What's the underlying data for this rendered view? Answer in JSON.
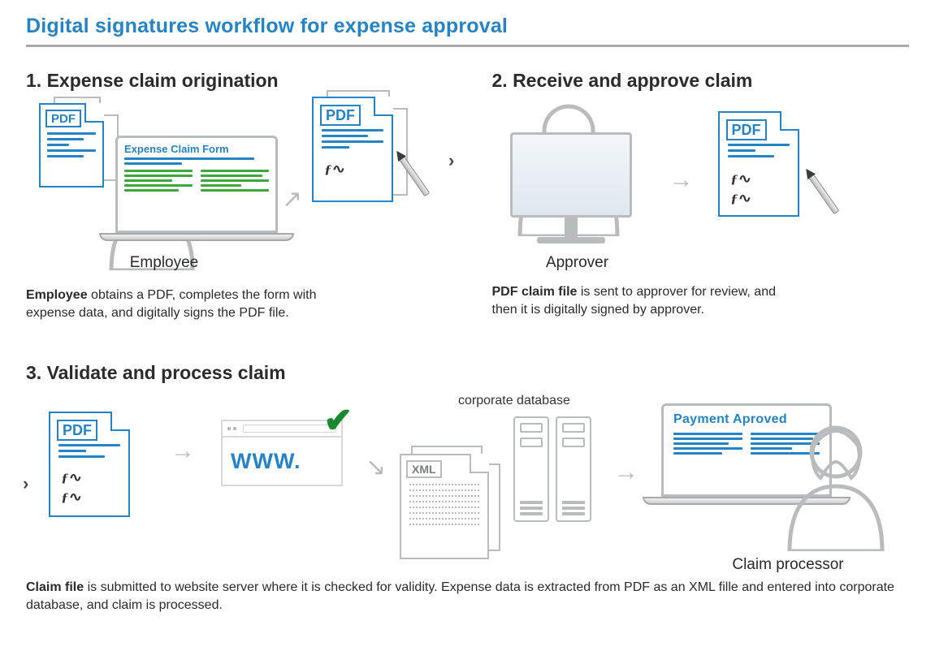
{
  "title": "Digital signatures workflow for expense approval",
  "pdf_badge": "PDF",
  "xml_badge": "XML",
  "www_text": "WWW.",
  "step1": {
    "heading": "1. Expense claim origination",
    "form_title": "Expense Claim Form",
    "actor": "Employee",
    "desc_bold": "Employee",
    "desc_rest": " obtains a PDF, completes the form with expense data, and digitally signs the PDF file."
  },
  "step2": {
    "heading": "2. Receive and approve claim",
    "actor": "Approver",
    "desc_bold": "PDF claim file",
    "desc_rest": " is sent to approver for review, and then it is digitally signed by approver."
  },
  "step3": {
    "heading": "3. Validate and process claim",
    "db_label": "corporate database",
    "paid_title": "Payment Aproved",
    "actor": "Claim processor",
    "desc_bold": "Claim file",
    "desc_rest": " is submitted to website server where it is checked for validity. Expense data is extracted from PDF as an XML fille and entered into corporate database, and claim is processed."
  }
}
